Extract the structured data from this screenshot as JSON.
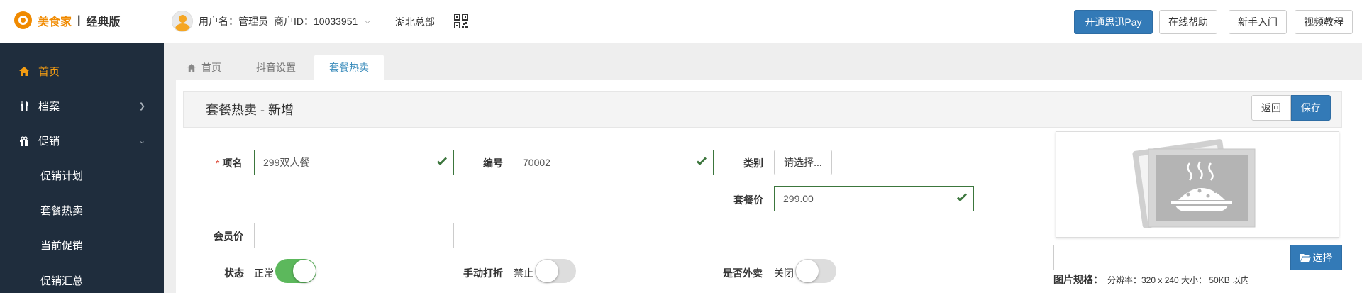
{
  "header": {
    "brand": "美食家",
    "separator": "|",
    "edition": "经典版",
    "user_label": "用户名：管理员",
    "merchant_label": "商户ID：10033951",
    "region": "湖北总部",
    "buttons": [
      "开通思迅Pay",
      "在线帮助",
      "新手入门",
      "视频教程"
    ]
  },
  "sidebar": {
    "items": [
      {
        "label": "首页",
        "icon": "home-icon"
      },
      {
        "label": "档案",
        "icon": "cutlery-icon"
      },
      {
        "label": "促销",
        "icon": "gift-icon"
      }
    ],
    "subitems": [
      "促销计划",
      "套餐热卖",
      "当前促销",
      "促销汇总"
    ]
  },
  "tabs": [
    "首页",
    "抖音设置",
    "套餐热卖"
  ],
  "page": {
    "title": "套餐热卖 - 新增",
    "back_label": "返回",
    "save_label": "保存"
  },
  "form": {
    "required_mark": "*",
    "name_label": "项名",
    "name_value": "299双人餐",
    "code_label": "编号",
    "code_value": "70002",
    "category_label": "类别",
    "category_button": "请选择...",
    "price_label": "套餐价",
    "price_value": "299.00",
    "member_price_label": "会员价",
    "member_price_value": "",
    "status_label": "状态",
    "status_text": "正常",
    "status_on": true,
    "discount_label": "手动打折",
    "discount_text": "禁止",
    "discount_on": false,
    "takeout_label": "是否外卖",
    "takeout_text": "关闭",
    "takeout_on": false
  },
  "image": {
    "choose_label": "选择",
    "spec_label": "图片规格：",
    "spec_text": "分辨率：320 x 240 大小： 50KB 以内"
  },
  "colors": {
    "brand": "#f08a00",
    "primary": "#337ab7",
    "sidebar_bg": "#1f2d3d",
    "active_nav": "#f39c12",
    "success": "#3c763d",
    "toggle_on": "#5cb85c"
  }
}
